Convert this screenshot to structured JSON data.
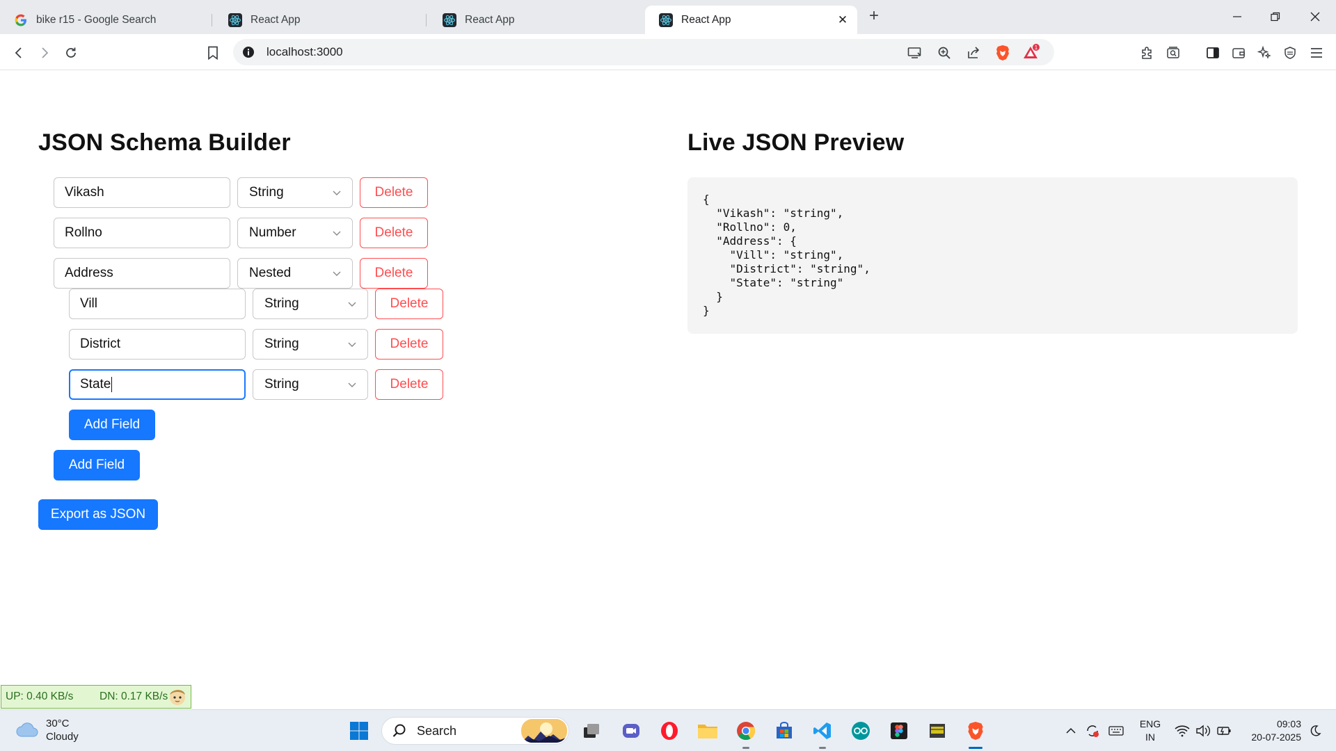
{
  "browser": {
    "tabs": [
      {
        "title": "bike r15 - Google Search",
        "favicon": "google-icon",
        "active": false
      },
      {
        "title": "React App",
        "favicon": "react-icon",
        "active": false
      },
      {
        "title": "React App",
        "favicon": "react-icon",
        "active": false
      },
      {
        "title": "React App",
        "favicon": "react-icon",
        "active": true
      }
    ],
    "address": "localhost:3000",
    "notification_badge": "1"
  },
  "app": {
    "builder_title": "JSON Schema Builder",
    "preview_title": "Live JSON Preview",
    "fields": [
      {
        "name": "Vikash",
        "type": "String",
        "delete_label": "Delete"
      },
      {
        "name": "Rollno",
        "type": "Number",
        "delete_label": "Delete"
      },
      {
        "name": "Address",
        "type": "Nested",
        "delete_label": "Delete",
        "children": [
          {
            "name": "Vill",
            "type": "String",
            "delete_label": "Delete"
          },
          {
            "name": "District",
            "type": "String",
            "delete_label": "Delete"
          },
          {
            "name": "State",
            "type": "String",
            "delete_label": "Delete",
            "focused": true
          }
        ]
      }
    ],
    "nested_add_label": "Add Field",
    "add_label": "Add Field",
    "export_label": "Export as JSON",
    "json_preview": "{\n  \"Vikash\": \"string\",\n  \"Rollno\": 0,\n  \"Address\": {\n    \"Vill\": \"string\",\n    \"District\": \"string\",\n    \"State\": \"string\"\n  }\n}",
    "accent_color": "#1677ff",
    "danger_color": "#ff4d4f"
  },
  "netspeed": {
    "up": "UP: 0.40 KB/s",
    "down": "DN: 0.17 KB/s"
  },
  "taskbar": {
    "weather": {
      "temp": "30°C",
      "condition": "Cloudy"
    },
    "search_placeholder": "Search",
    "lang": {
      "line1": "ENG",
      "line2": "IN"
    },
    "time": "09:03",
    "date": "20-07-2025"
  }
}
